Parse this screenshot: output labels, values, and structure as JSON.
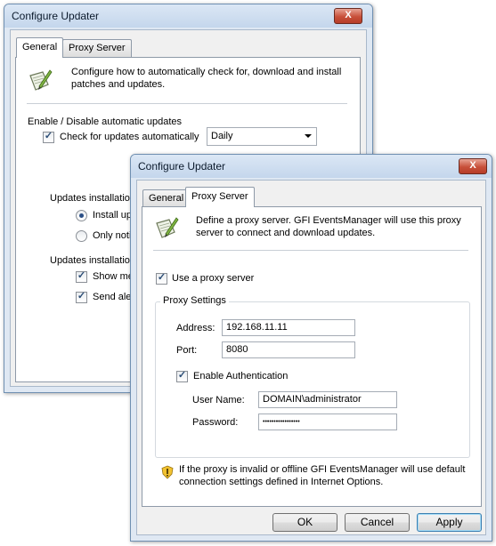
{
  "back_window": {
    "title": "Configure Updater",
    "close_label": "X",
    "tabs": [
      {
        "label": "General",
        "active": true
      },
      {
        "label": "Proxy Server",
        "active": false
      }
    ],
    "description": [
      "Configure how to automatically check for, download and install",
      "patches and updates."
    ],
    "enable_section_label": "Enable / Disable automatic updates",
    "check_updates_label": "Check for updates automatically",
    "check_updates_checked": true,
    "frequency_value": "Daily",
    "updates_installation_label": "Updates installation",
    "install_option_label": "Install upda",
    "only_notify_label": "Only notify",
    "updates_notify_label": "Updates installation n",
    "show_messages_label": "Show mess",
    "send_alerts_label": "Send alerts"
  },
  "front_window": {
    "title": "Configure Updater",
    "close_label": "X",
    "tabs": [
      {
        "label": "General",
        "active": false
      },
      {
        "label": "Proxy Server",
        "active": true
      }
    ],
    "description": [
      "Define a proxy server. GFI EventsManager will use this proxy",
      "server to connect and download updates."
    ],
    "use_proxy_label": "Use a proxy server",
    "use_proxy_checked": true,
    "proxy_settings_label": "Proxy Settings",
    "address_label": "Address:",
    "address_value": "192.168.11.11",
    "port_label": "Port:",
    "port_value": "8080",
    "enable_auth_label": "Enable Authentication",
    "enable_auth_checked": true,
    "username_label": "User Name:",
    "username_value": "DOMAIN\\administrator",
    "password_label": "Password:",
    "password_value": "•••••••••••••••••",
    "warning_text": [
      "If the proxy is invalid or offline GFI EventsManager will use default",
      "connection settings defined in Internet Options."
    ],
    "buttons": {
      "ok": "OK",
      "cancel": "Cancel",
      "apply": "Apply"
    }
  },
  "icons": {
    "settings": "notepad-pencil-icon",
    "warning": "warning-shield-icon",
    "checkmark": "✓"
  }
}
